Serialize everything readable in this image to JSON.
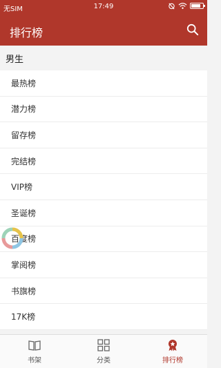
{
  "status": {
    "carrier": "无SIM",
    "time": "17:49",
    "icons": [
      "alarm-icon",
      "wifi-icon",
      "battery-icon"
    ]
  },
  "header": {
    "title": "排行榜",
    "search_icon": "search-icon"
  },
  "section": {
    "title": "男生"
  },
  "items": [
    {
      "label": "最热榜"
    },
    {
      "label": "潜力榜"
    },
    {
      "label": "留存榜"
    },
    {
      "label": "完结榜"
    },
    {
      "label": "VIP榜"
    },
    {
      "label": "圣诞榜"
    },
    {
      "label": "百度榜"
    },
    {
      "label": "掌阅榜"
    },
    {
      "label": "书旗榜"
    },
    {
      "label": "17K榜"
    }
  ],
  "tabs": [
    {
      "label": "书架",
      "icon": "book-icon",
      "active": false
    },
    {
      "label": "分类",
      "icon": "grid-icon",
      "active": false
    },
    {
      "label": "排行榜",
      "icon": "medal-icon",
      "active": true
    }
  ],
  "colors": {
    "accent": "#b0372b"
  }
}
